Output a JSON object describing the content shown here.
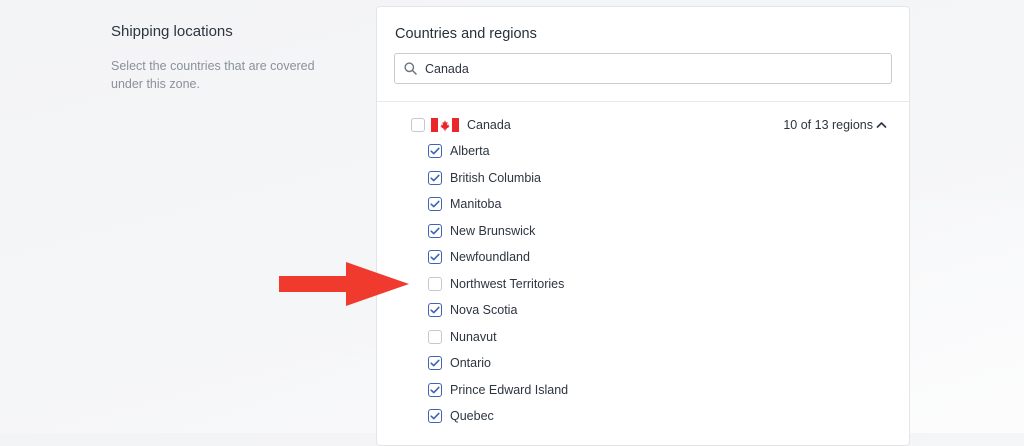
{
  "left": {
    "title": "Shipping locations",
    "description_line1": "Select the countries that are covered",
    "description_line2": "under this zone."
  },
  "card": {
    "title": "Countries and regions",
    "search": {
      "value": "Canada",
      "icon": "search-icon"
    }
  },
  "country": {
    "name": "Canada",
    "flag": "canada-flag-icon",
    "checked": false,
    "region_count": "10 of 13 regions",
    "expanded": true,
    "regions": [
      {
        "label": "Alberta",
        "checked": true
      },
      {
        "label": "British Columbia",
        "checked": true
      },
      {
        "label": "Manitoba",
        "checked": true
      },
      {
        "label": "New Brunswick",
        "checked": true
      },
      {
        "label": "Newfoundland",
        "checked": true
      },
      {
        "label": "Northwest Territories",
        "checked": false
      },
      {
        "label": "Nova Scotia",
        "checked": true
      },
      {
        "label": "Nunavut",
        "checked": false
      },
      {
        "label": "Ontario",
        "checked": true
      },
      {
        "label": "Prince Edward Island",
        "checked": true
      },
      {
        "label": "Quebec",
        "checked": true
      }
    ]
  },
  "colors": {
    "accent": "#3f63b5",
    "annotation_arrow": "#f03a2e",
    "flag_red": "#e8262b"
  }
}
